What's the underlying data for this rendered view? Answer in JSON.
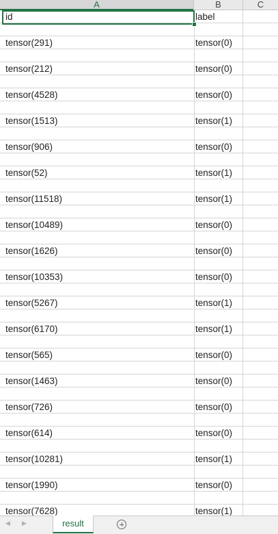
{
  "columns": [
    "A",
    "B",
    "C"
  ],
  "header_row": {
    "id": "id",
    "label": "label"
  },
  "rows": [
    {
      "id": "tensor(291)",
      "label": "tensor(0)"
    },
    {
      "id": "tensor(212)",
      "label": "tensor(0)"
    },
    {
      "id": "tensor(4528)",
      "label": "tensor(0)"
    },
    {
      "id": "tensor(1513)",
      "label": "tensor(1)"
    },
    {
      "id": "tensor(906)",
      "label": "tensor(0)"
    },
    {
      "id": "tensor(52)",
      "label": "tensor(1)"
    },
    {
      "id": "tensor(11518)",
      "label": "tensor(1)"
    },
    {
      "id": "tensor(10489)",
      "label": "tensor(0)"
    },
    {
      "id": "tensor(1626)",
      "label": "tensor(0)"
    },
    {
      "id": "tensor(10353)",
      "label": "tensor(0)"
    },
    {
      "id": "tensor(5267)",
      "label": "tensor(1)"
    },
    {
      "id": "tensor(6170)",
      "label": "tensor(1)"
    },
    {
      "id": "tensor(565)",
      "label": "tensor(0)"
    },
    {
      "id": "tensor(1463)",
      "label": "tensor(0)"
    },
    {
      "id": "tensor(726)",
      "label": "tensor(0)"
    },
    {
      "id": "tensor(614)",
      "label": "tensor(0)"
    },
    {
      "id": "tensor(10281)",
      "label": "tensor(1)"
    },
    {
      "id": "tensor(1990)",
      "label": "tensor(0)"
    },
    {
      "id": "tensor(7628)",
      "label": "tensor(1)"
    }
  ],
  "sheet_tab": {
    "name": "result"
  },
  "accent_color": "#217346"
}
